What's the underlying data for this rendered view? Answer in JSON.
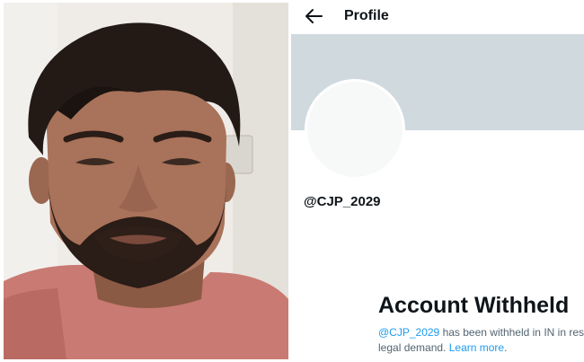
{
  "header": {
    "title": "Profile",
    "back_icon": "arrow-left-icon"
  },
  "profile": {
    "handle": "@CJP_2029",
    "withheld_title": "Account Withheld",
    "withheld_mention": "@CJP_2029",
    "withheld_text_1": " has been withheld in IN in res",
    "withheld_text_2": "legal demand. ",
    "learn_more": "Learn more",
    "withheld_text_end": "."
  },
  "colors": {
    "banner": "#cfd9de",
    "link": "#1d9bf0",
    "shirt": "#c97a72"
  }
}
